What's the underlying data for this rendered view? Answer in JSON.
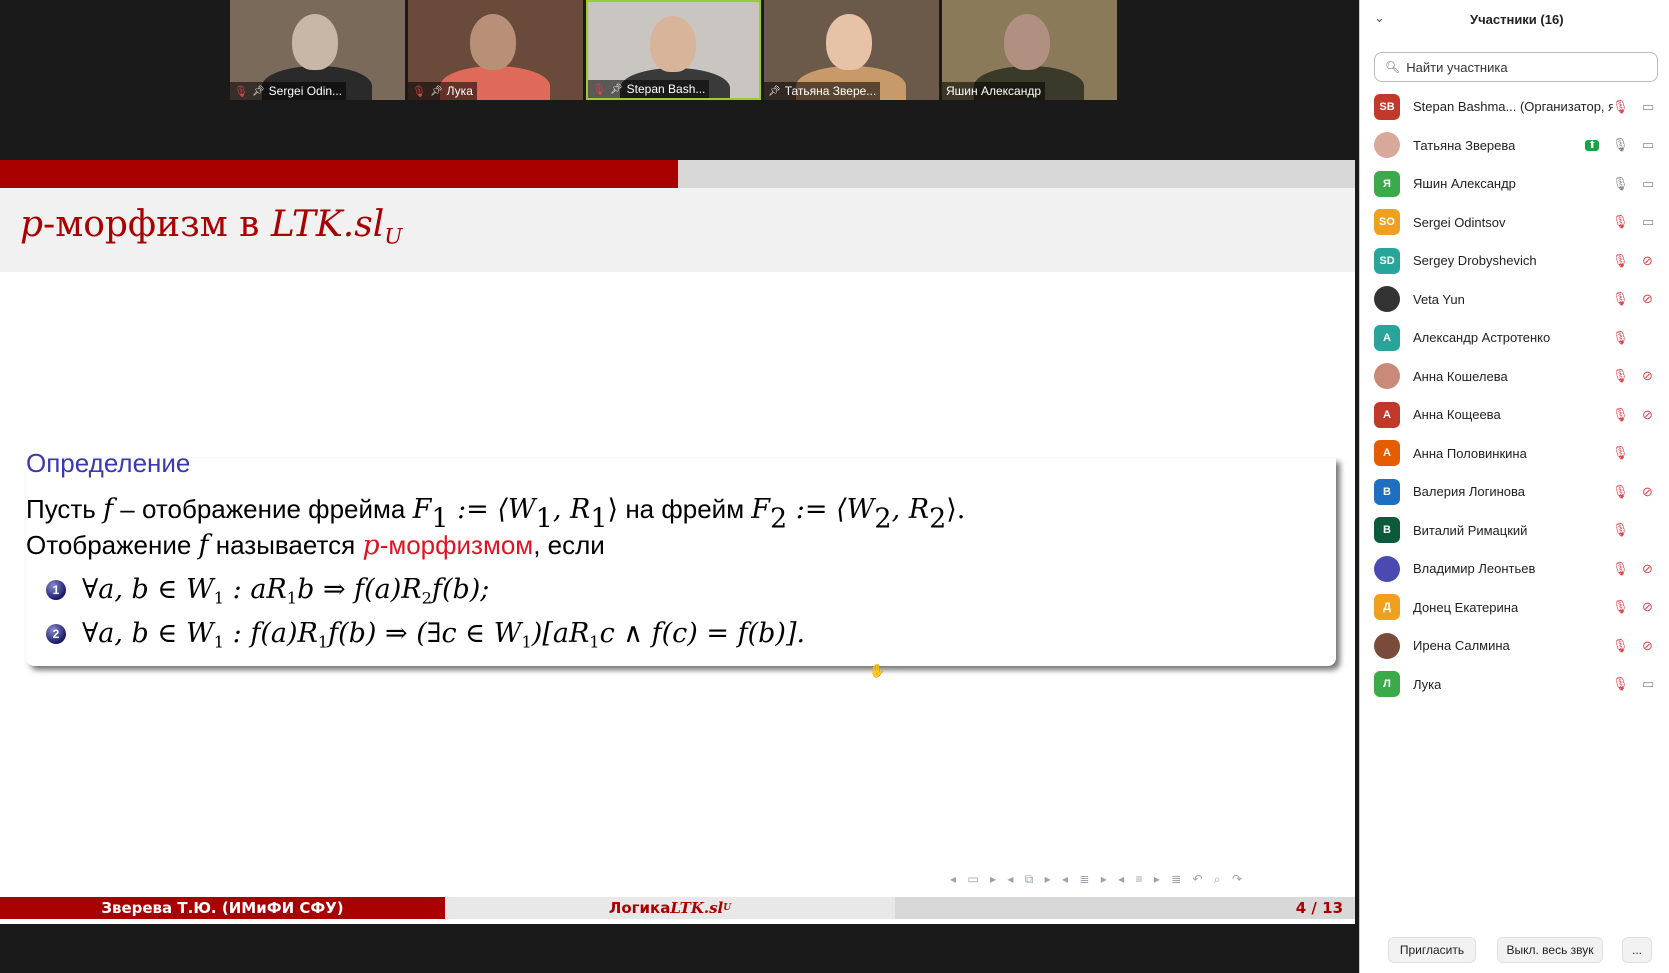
{
  "videos": [
    {
      "name": "Sergei Odin...",
      "mic": "muted",
      "pinned": true,
      "colors": {
        "bg": "#7a6a5a",
        "head": "#c8b7a6",
        "body": "#2a2a2a"
      }
    },
    {
      "name": "Лука",
      "mic": "muted",
      "pinned": true,
      "colors": {
        "bg": "#6a4a3a",
        "head": "#b89078",
        "body": "#e06a5a"
      }
    },
    {
      "name": "Stepan Bash...",
      "mic": "muted",
      "pinned": true,
      "active": true,
      "colors": {
        "bg": "#c9c6c2",
        "head": "#d8b49a",
        "body": "#3a3a3a"
      }
    },
    {
      "name": "Татьяна Зверe...",
      "mic": "on",
      "pinned": true,
      "colors": {
        "bg": "#6b5a4a",
        "head": "#e6c2a6",
        "body": "#c89a6a"
      }
    },
    {
      "name": "Яшин Александр",
      "mic": "on",
      "pinned": false,
      "colors": {
        "bg": "#8a7a5a",
        "head": "#b09080",
        "body": "#3a3a2a"
      }
    }
  ],
  "slide": {
    "progress": 0.5,
    "title_p": "p",
    "title_text": "-морфизм в ",
    "title_math": "LTK.sl",
    "title_sub": "U",
    "def_title": "Определение",
    "line1": {
      "t1": "Пусть ",
      "m1": "f",
      "t2": " – отображение фрейма ",
      "m2": "F",
      "m2sub": "1",
      "m3": " := ⟨W",
      "m3sub": "1",
      "m4": ", R",
      "m4sub": "1",
      "m5": "⟩",
      "t3": " на фрейм ",
      "m6": "F",
      "m6sub": "2",
      "m7": " := ⟨W",
      "m7sub": "2",
      "m8": ", R",
      "m8sub": "2",
      "m9": "⟩."
    },
    "line2": {
      "t1": "Отображение ",
      "m1": "f",
      "t2": " называется ",
      "m_red": "p",
      "t_red": "-морфизмом",
      "t3": ", если"
    },
    "items": [
      {
        "num": "1",
        "a": "∀a, b ∈ W",
        "asub": "1",
        "b": " : aR",
        "bsub": "1",
        "c": "b ⇒ f(a)R",
        "csub": "2",
        "d": "f(b);"
      },
      {
        "num": "2",
        "a": "∀a, b ∈ W",
        "asub": "1",
        "b": " : f(a)R",
        "bsub": "1",
        "c": "f(b) ⇒ (∃c ∈ W",
        "csub": "1",
        "d": ")[aR",
        "dsub": "1",
        "e": "c ∧ f(c) = f(b)]."
      }
    ],
    "nav_icons": "◂ ▭ ▸  ◂ ⧉ ▸  ◂ ≣ ▸  ◂ ≡ ▸  ≣   ↶ ⌕ ↷",
    "footer_left": "Зверева Т.Ю.  (ИМиФИ СФУ)",
    "footer_mid_text": "Логика ",
    "footer_mid_math": "LTK.sl",
    "footer_mid_sub": "U",
    "footer_right": "4 / 13"
  },
  "panel": {
    "title": "Участники (16)",
    "search_placeholder": "Найти участника",
    "participants": [
      {
        "initials": "SB",
        "name": "Stepan Bashma... (Организатор, я)",
        "color": "#c0392b",
        "mic": "muted",
        "cam": "on",
        "photo": false
      },
      {
        "initials": "",
        "name": "Татьяна Зверева",
        "color": "#d8a89a",
        "mic": "on",
        "cam": "on",
        "share": true,
        "photo": true
      },
      {
        "initials": "Я",
        "name": "Яшин Александр",
        "color": "#3aaa4a",
        "mic": "on",
        "cam": "on",
        "photo": false
      },
      {
        "initials": "SO",
        "name": "Sergei Odintsov",
        "color": "#f0a020",
        "mic": "muted",
        "cam": "on",
        "photo": false
      },
      {
        "initials": "SD",
        "name": "Sergey Drobyshevich",
        "color": "#26a69a",
        "mic": "muted",
        "cam": "off",
        "photo": false
      },
      {
        "initials": "",
        "name": "Veta Yun",
        "color": "#333333",
        "mic": "muted",
        "cam": "off",
        "photo": true
      },
      {
        "initials": "А",
        "name": "Александр Астротенко",
        "color": "#26a69a",
        "mic": "muted",
        "cam": "none",
        "photo": false
      },
      {
        "initials": "",
        "name": "Анна Кошелева",
        "color": "#c98a7a",
        "mic": "muted",
        "cam": "off",
        "photo": true
      },
      {
        "initials": "А",
        "name": "Анна Кощеева",
        "color": "#c0392b",
        "mic": "muted",
        "cam": "off",
        "photo": false
      },
      {
        "initials": "А",
        "name": "Анна Половинкина",
        "color": "#e65c00",
        "mic": "muted",
        "cam": "none",
        "photo": false
      },
      {
        "initials": "В",
        "name": "Валерия Логинова",
        "color": "#1e6fc0",
        "mic": "muted",
        "cam": "off",
        "photo": false
      },
      {
        "initials": "В",
        "name": "Виталий Римацкий",
        "color": "#0b5a3a",
        "mic": "muted",
        "cam": "none",
        "photo": false
      },
      {
        "initials": "",
        "name": "Владимир Леонтьев",
        "color": "#4a4ab0",
        "mic": "muted",
        "cam": "off",
        "photo": true
      },
      {
        "initials": "Д",
        "name": "Донец Екатерина",
        "color": "#f0a020",
        "mic": "muted",
        "cam": "off",
        "photo": false
      },
      {
        "initials": "",
        "name": "Ирена Салмина",
        "color": "#7a4a3a",
        "mic": "muted",
        "cam": "off",
        "photo": true
      },
      {
        "initials": "Л",
        "name": "Лука",
        "color": "#3aaa4a",
        "mic": "muted",
        "cam": "on",
        "photo": false
      }
    ],
    "buttons": {
      "invite": "Пригласить",
      "mute_all": "Выкл. весь звук",
      "more": "..."
    }
  }
}
